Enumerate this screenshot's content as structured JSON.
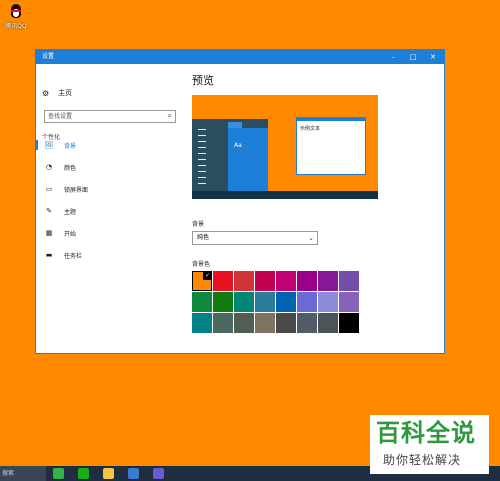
{
  "desktop": {
    "icon_label": "腾讯QQ"
  },
  "window": {
    "title": "设置",
    "controls": {
      "minimize": "–",
      "maximize": "□",
      "close": "✕"
    }
  },
  "sidebar": {
    "home_label": "主页",
    "search_placeholder": "查找设置",
    "section_heading": "个性化",
    "items": [
      {
        "label": "背景",
        "icon": "image-icon",
        "glyph": "🖼",
        "active": true
      },
      {
        "label": "颜色",
        "icon": "palette-icon",
        "glyph": "◔",
        "active": false
      },
      {
        "label": "锁屏界面",
        "icon": "lockscreen-icon",
        "glyph": "▭",
        "active": false
      },
      {
        "label": "主题",
        "icon": "theme-icon",
        "glyph": "✎",
        "active": false
      },
      {
        "label": "开始",
        "icon": "start-icon",
        "glyph": "▦",
        "active": false
      },
      {
        "label": "任务栏",
        "icon": "taskbar-icon",
        "glyph": "▬",
        "active": false
      }
    ]
  },
  "main": {
    "preview_heading": "预览",
    "preview_tile_text": "Aa",
    "preview_window_text": "示例文本",
    "background_label": "背景",
    "background_value": "纯色",
    "color_label": "背景色",
    "selected_color": "#ff8a00",
    "colors": [
      "#ff8a00",
      "#e81123",
      "#d13438",
      "#c30052",
      "#bf0077",
      "#9a0089",
      "#881798",
      "#744da9",
      "#10893e",
      "#107c10",
      "#018574",
      "#2d7d9a",
      "#0063b1",
      "#6b69d6",
      "#8e8cd8",
      "#8764b8",
      "#038387",
      "#486860",
      "#525e54",
      "#7e735f",
      "#4c4a48",
      "#515c6b",
      "#4a5459",
      "#000000"
    ]
  },
  "taskbar": {
    "search_text": "搜索",
    "apps": [
      {
        "name": "browser-icon",
        "color": "#35b24a"
      },
      {
        "name": "wechat-icon",
        "color": "#1aad19"
      },
      {
        "name": "folder-icon",
        "color": "#f4c542"
      },
      {
        "name": "store-icon",
        "color": "#3a7bd5"
      },
      {
        "name": "vpn-icon",
        "color": "#6b5bd2"
      },
      {
        "name": "settings-icon",
        "color": "#2b6cb0"
      }
    ]
  },
  "watermark": {
    "title": "百科全说",
    "subtitle": "助你轻松解决"
  }
}
